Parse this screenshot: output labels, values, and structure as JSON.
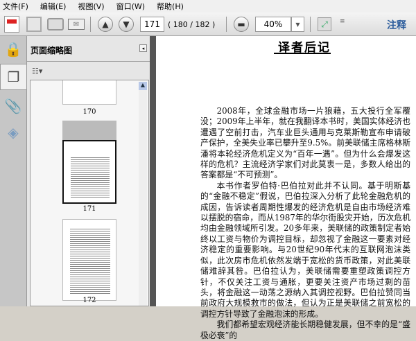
{
  "menu": [
    "文件(F)",
    "编辑(E)",
    "视图(V)",
    "窗口(W)",
    "帮助(H)"
  ],
  "toolbar": {
    "page_input": "171",
    "page_info": "( 180 / 182 )",
    "zoom": "40%",
    "comment_label": "注释"
  },
  "panel": {
    "title": "页面缩略图",
    "thumbnails": [
      {
        "label": "170"
      },
      {
        "label": "171"
      },
      {
        "label": "172"
      }
    ]
  },
  "document": {
    "title": "译者后记",
    "paragraphs": [
      "2008年，全球金融市场一片狼藉，五大投行全军覆没；2009年上半年，就在我翻译本书时，美国实体经济也遭遇了空前打击，汽车业巨头通用与克莱斯勒宣布申请破产保护，全美失业率已攀升至9.5%。前美联储主席格林斯潘将本轮经济危机定义为“百年一遇”。但为什么会爆发这样的危机？主流经济学家们对此莫衷一是，多数人给出的答案都是“不可预测”。",
      "本书作者罗伯特·巴伯拉对此并不认同。基于明斯基的“金融不稳定”假说，巴伯拉深入分析了此轮金融危机的成因，告诉读者周期性爆发的经济危机是自由市场经济难以摆脱的宿命，而从1987年的华尔街股灾开始，历次危机均由金融领域所引发。20多年来，美联储的政策制定者始终以工资与物价为调控目标，却忽视了金融这一要素对经济稳定的重要影响。与20世纪90年代末的互联网泡沫类似，此次房市危机依然发端于宽松的货币政策，对此美联储难辞其咎。巴伯拉认为，美联储需要重塑政策调控方针，不仅关注工资与通胀，更要关注资产市场过剩的苗头，将金融这一动荡之源纳入其调控视野。巴伯拉赞同当前政府大规模救市的做法，但认为正是美联储之前宽松的调控方针导致了金融泡沫的形成。",
      "我们都希望宏观经济能长期稳健发展，但不幸的是“盛极必衰”的"
    ]
  }
}
